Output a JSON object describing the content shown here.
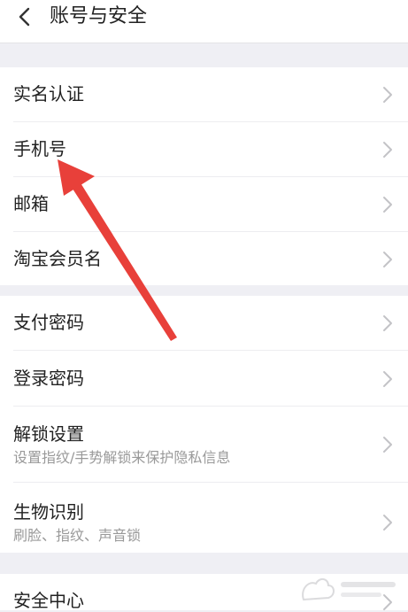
{
  "header": {
    "title": "账号与安全",
    "back_icon": "chevron-left-icon"
  },
  "group1": {
    "items": [
      {
        "label": "实名认证"
      },
      {
        "label": "手机号"
      },
      {
        "label": "邮箱"
      },
      {
        "label": "淘宝会员名"
      }
    ]
  },
  "group2": {
    "items": [
      {
        "label": "支付密码"
      },
      {
        "label": "登录密码"
      },
      {
        "label": "解锁设置",
        "sublabel": "设置指纹/手势解锁来保护隐私信息"
      },
      {
        "label": "生物识别",
        "sublabel": "刷脸、指纹、声音锁"
      }
    ]
  },
  "group3": {
    "items": [
      {
        "label": "安全中心"
      }
    ]
  },
  "annotation": {
    "arrow_color": "#e8403a"
  }
}
